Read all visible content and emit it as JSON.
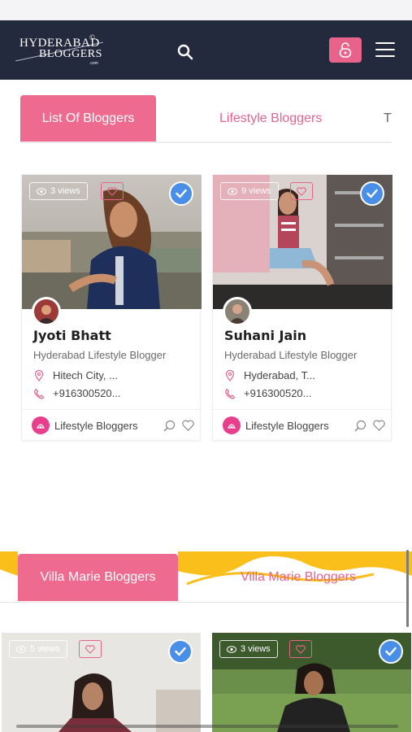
{
  "header": {
    "logo_line1": "HYDERABAD",
    "logo_line2": "BLOGGERS",
    "logo_suffix": ".com"
  },
  "icons": {
    "search": "search-icon",
    "lock": "lock-open-icon",
    "menu": "hamburger-menu-icon",
    "eye": "eye-icon",
    "heart": "heart-icon",
    "verified": "check-badge-icon",
    "location": "location-pin-icon",
    "phone": "phone-icon",
    "share": "search-user-icon",
    "category": "lifestyle-category-icon"
  },
  "tabs": [
    {
      "label": "List Of Bloggers",
      "active": true
    },
    {
      "label": "Lifestyle Bloggers",
      "active": false
    },
    {
      "label": "T",
      "active": false
    }
  ],
  "cards": [
    {
      "views": "3 views",
      "name": "Jyoti Bhatt",
      "subtitle": "Hyderabad Lifestyle Blogger",
      "location": "Hitech City, ...",
      "phone": "+916300520...",
      "category": "Lifestyle Bloggers"
    },
    {
      "views": "9 views",
      "name": "Suhani Jain",
      "subtitle": "Hyderabad Lifestyle Blogger",
      "location": "Hyderabad, T...",
      "phone": "+916300520...",
      "category": "Lifestyle Bloggers"
    }
  ],
  "tabs2": [
    {
      "label": "Villa Marie Bloggers",
      "active": true
    },
    {
      "label": "Villa Marie Bloggers",
      "active": false
    }
  ],
  "cards2": [
    {
      "views": "5 views"
    },
    {
      "views": "3 views"
    }
  ],
  "colors": {
    "header_bg": "#232a3d",
    "accent_pink": "#ee6b8f",
    "verified_blue": "#4a8fe7",
    "banner_yellow": "#fbbf1b"
  }
}
